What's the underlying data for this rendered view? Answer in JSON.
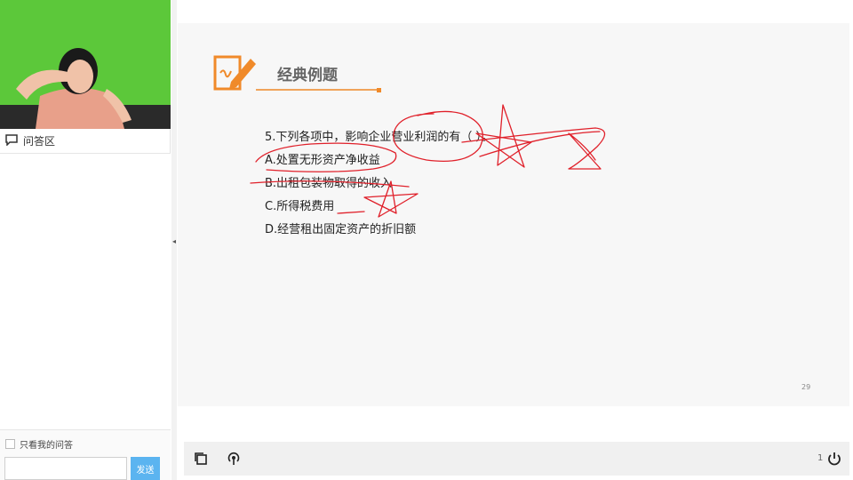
{
  "sidebar": {
    "qa_title": "问答区",
    "only_mine_label": "只看我的问答",
    "message_placeholder": "",
    "send_label": "发送"
  },
  "slide": {
    "title": "经典例题",
    "question": "5.下列各项中，影响企业营业利润的有（ ）。",
    "options": [
      "A.处置无形资产净收益",
      "B.出租包装物取得的收入",
      "C.所得税费用",
      "D.经营租出固定资产的折旧额"
    ],
    "page_number": "29"
  },
  "toolbar": {
    "count": "1"
  },
  "colors": {
    "video_bg": "#5cc83a",
    "accent_orange": "#f08a2a",
    "annotation_red": "#e0202a",
    "send_button": "#5bb4f0"
  },
  "icons": [
    "chat-bubble-icon",
    "pencil-note-icon",
    "copy-icon",
    "broadcast-icon",
    "power-icon",
    "collapse-arrow-icon"
  ]
}
